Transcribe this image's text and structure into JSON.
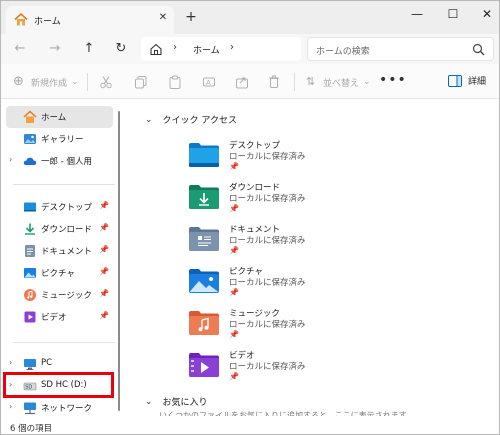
{
  "tab": {
    "title": "ホーム",
    "close": "✕",
    "new_tab": "+"
  },
  "window_controls": {
    "minimize": "—",
    "maximize": "☐",
    "close": "✕"
  },
  "nav": {
    "back": "←",
    "forward": "→",
    "up": "↑",
    "refresh": "↻"
  },
  "address": {
    "sep1": "›",
    "location": "ホーム",
    "sep2": "›"
  },
  "search": {
    "placeholder": "ホームの検索"
  },
  "toolbar": {
    "new": "新規作成",
    "new_caret": "⌄",
    "sort": "並べ替え",
    "sort_caret": "⌄",
    "more": "•••",
    "details": "詳細"
  },
  "sidebar": {
    "top": [
      {
        "label": "ホーム",
        "icon": "home-icon"
      },
      {
        "label": "ギャラリー",
        "icon": "gallery-icon"
      },
      {
        "label": "一郎 - 個人用",
        "icon": "cloud-icon"
      }
    ],
    "pinned": [
      {
        "label": "デスクトップ",
        "icon": "desktop-folder-icon"
      },
      {
        "label": "ダウンロード",
        "icon": "download-folder-icon"
      },
      {
        "label": "ドキュメント",
        "icon": "documents-folder-icon"
      },
      {
        "label": "ピクチャ",
        "icon": "pictures-folder-icon"
      },
      {
        "label": "ミュージック",
        "icon": "music-folder-icon"
      },
      {
        "label": "ビデオ",
        "icon": "videos-folder-icon"
      }
    ],
    "pin_glyph": "📌",
    "devices": [
      {
        "label": "PC",
        "icon": "pc-icon"
      },
      {
        "label": "SD HC (D:)",
        "icon": "sd-card-icon"
      },
      {
        "label": "ネットワーク",
        "icon": "network-icon"
      }
    ],
    "chevron": "›"
  },
  "main": {
    "quick_access_title": "クイック アクセス",
    "favorites_title": "お気に入り",
    "section_chevron": "⌄",
    "status": "ローカルに保存済み",
    "pin": "📌",
    "items": [
      {
        "name": "デスクトップ",
        "color": "#1a8fd8"
      },
      {
        "name": "ダウンロード",
        "color": "#1b9a73"
      },
      {
        "name": "ドキュメント",
        "color": "#7b93ad"
      },
      {
        "name": "ピクチャ",
        "color": "#1a7fe0"
      },
      {
        "name": "ミュージック",
        "color": "#ef7b52"
      },
      {
        "name": "ビデオ",
        "color": "#8a3fd6"
      }
    ],
    "partial_text": "いくつかのファイルをお気に入りに追加すると、ここに表示されます。"
  },
  "status_bar": {
    "count": "6 個の項目"
  },
  "colors": {
    "highlight": "#e8000b",
    "selected": "#e6e6e6",
    "accent": "#0067c0"
  }
}
